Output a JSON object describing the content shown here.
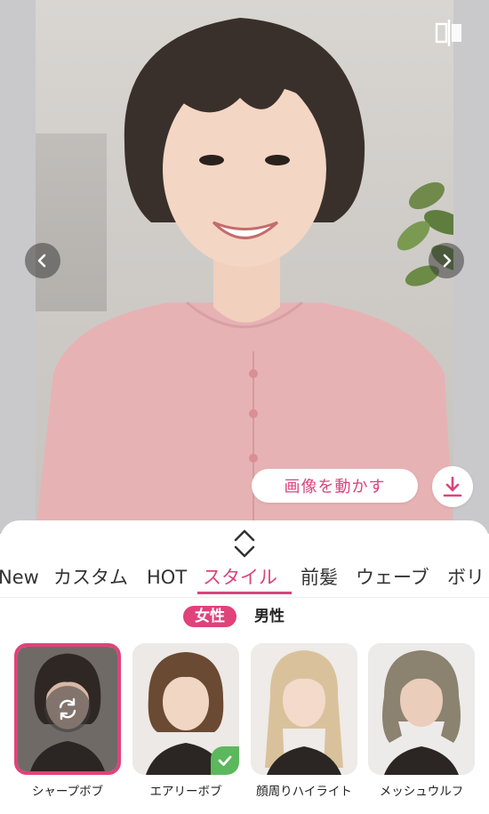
{
  "preview": {
    "move_image_label": "画像を動かす",
    "icons": {
      "compare": "compare-icon",
      "download": "download-icon",
      "prev": "chevron-left-icon",
      "next": "chevron-right-icon"
    }
  },
  "sheet": {
    "tabs": [
      {
        "label": "New"
      },
      {
        "label": "カスタム"
      },
      {
        "label": "HOT"
      },
      {
        "label": "スタイル",
        "active": true
      },
      {
        "label": "前髪"
      },
      {
        "label": "ウェーブ"
      },
      {
        "label": "ボリ"
      }
    ],
    "gender": {
      "female": "女性",
      "male": "男性",
      "selected": "女性"
    },
    "styles": [
      {
        "label": "シャープボブ",
        "selected": true
      },
      {
        "label": "エアリーボブ",
        "checked": true
      },
      {
        "label": "顔周りハイライト"
      },
      {
        "label": "メッシュウルフ"
      }
    ]
  },
  "colors": {
    "accent": "#e0427a",
    "accent_text": "#d9457a",
    "check": "#5cb85c"
  }
}
